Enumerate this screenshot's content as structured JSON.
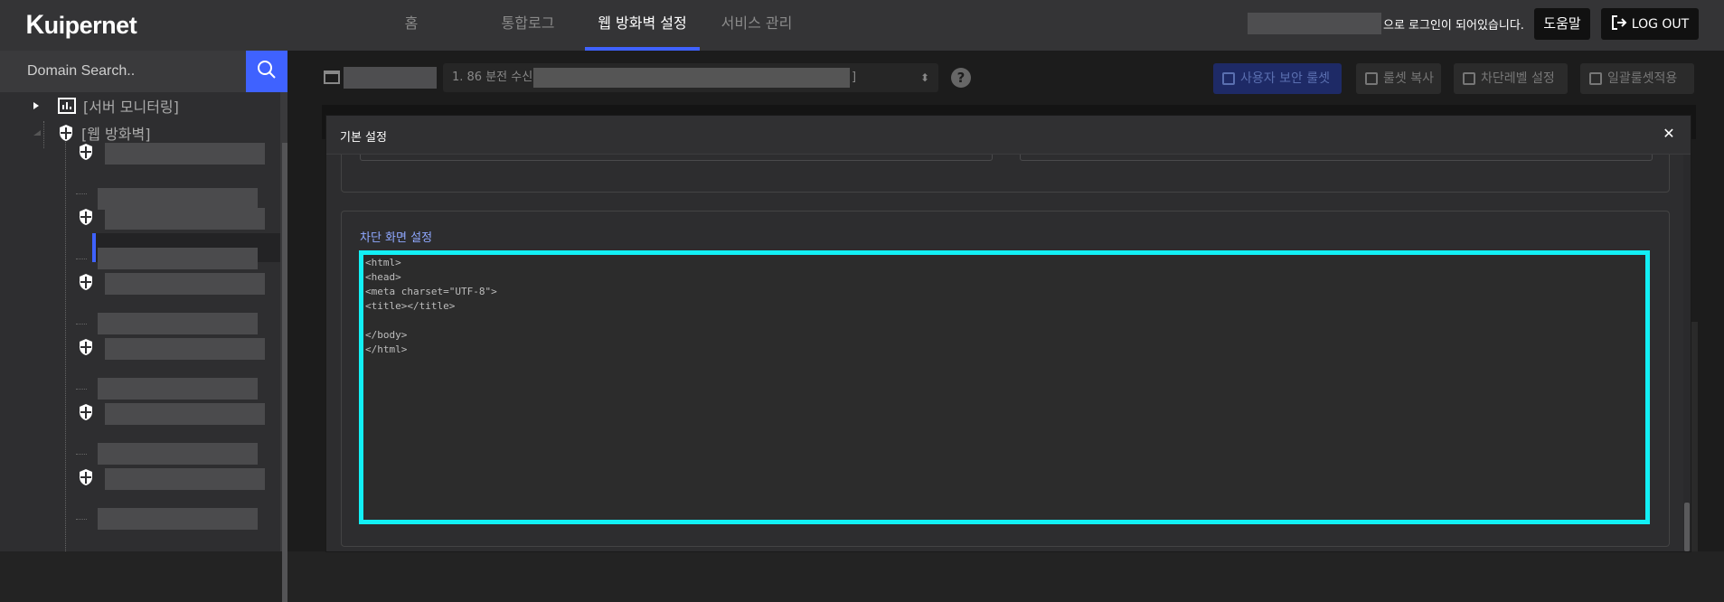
{
  "app": {
    "logo_text": "uipernet",
    "logo_k": "K"
  },
  "nav": {
    "items": [
      "홈",
      "통합로그",
      "웹 방화벽 설정",
      "서비스 관리"
    ],
    "active_index": 2
  },
  "user": {
    "login_suffix": "으로 로그인이 되어있습니다.",
    "help_label": "도움말",
    "logout_label": "LOG OUT"
  },
  "sidebar": {
    "search_placeholder": "Domain Search..",
    "tree": {
      "server_monitoring": "[서버 모니터링]",
      "web_firewall": "[웹 방화벽]"
    }
  },
  "toolbar": {
    "refresh_text": "1. 86 분전 수신[",
    "refresh_close": "]",
    "buttons": [
      "사용자 보안 룰셋",
      "룰셋 복사",
      "차단레벨 설정",
      "일괄룰셋적용"
    ]
  },
  "modal": {
    "title": "기본 설정",
    "close_symbol": "✕",
    "section_label": "차단 화면 설정",
    "editor_content": "<html>\n<head>\n<meta charset=\"UTF-8\">\n<title></title>\n\n</body>\n</html>"
  },
  "colors": {
    "accent": "#3f62ff",
    "focus_border": "#12f0f5",
    "topbar": "#343436"
  }
}
